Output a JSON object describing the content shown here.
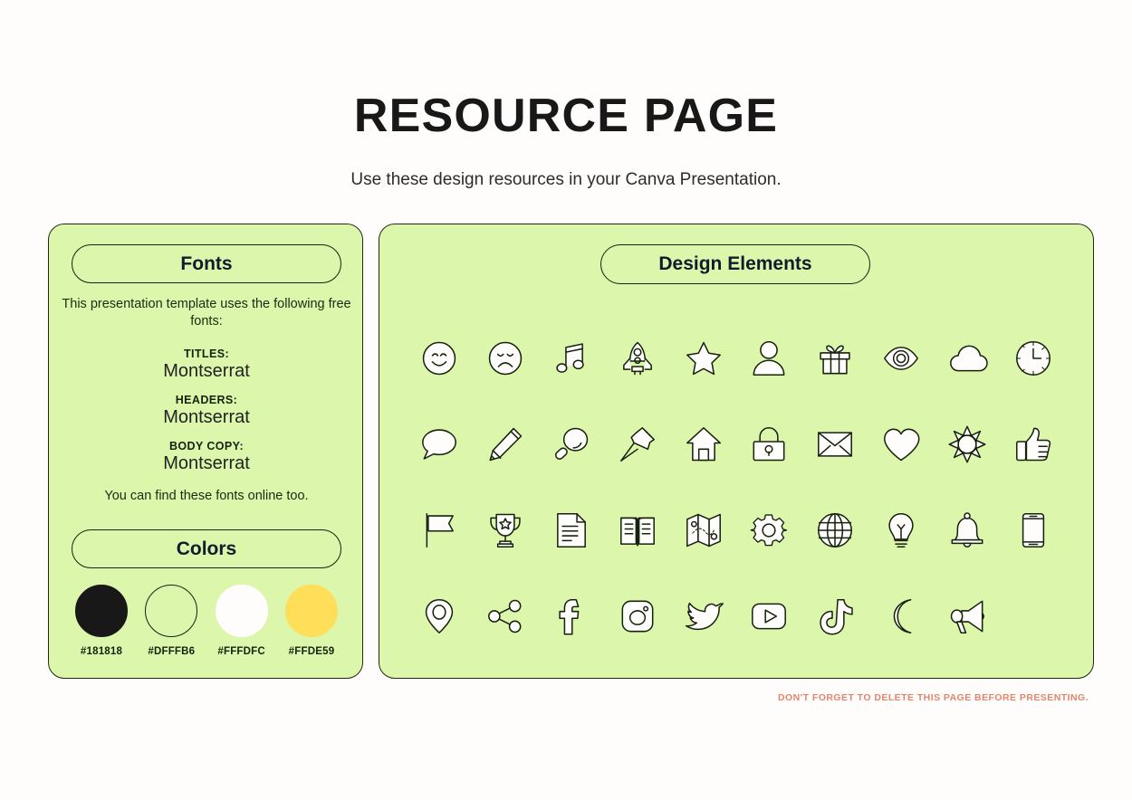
{
  "header": {
    "title": "RESOURCE PAGE",
    "subtitle": "Use these design resources in your Canva Presentation."
  },
  "fonts_panel": {
    "pill_label": "Fonts",
    "intro": "This presentation template uses the following free fonts:",
    "groups": [
      {
        "role": "TITLES:",
        "font": "Montserrat"
      },
      {
        "role": "HEADERS:",
        "font": "Montserrat"
      },
      {
        "role": "BODY COPY:",
        "font": "Montserrat"
      }
    ],
    "outro": "You can find these fonts online too."
  },
  "colors_section": {
    "pill_label": "Colors",
    "swatches": [
      {
        "hex": "#181818",
        "fill": "#181818",
        "stroke": "#181818",
        "name": "swatch-black"
      },
      {
        "hex": "#DFFFB6",
        "fill": "#dcf7ac",
        "stroke": "#16210e",
        "name": "swatch-green"
      },
      {
        "hex": "#FFFDFC",
        "fill": "#FFFDFC",
        "stroke": "#FFFDFC",
        "name": "swatch-offwhite"
      },
      {
        "hex": "#FFDE59",
        "fill": "#FFDE59",
        "stroke": "#FFDE59",
        "name": "swatch-yellow"
      }
    ]
  },
  "elements_panel": {
    "pill_label": "Design Elements",
    "icons": [
      "smiley-face-icon",
      "sad-face-icon",
      "music-note-icon",
      "rocket-icon",
      "star-icon",
      "person-icon",
      "gift-icon",
      "eye-icon",
      "cloud-icon",
      "clock-icon",
      "speech-bubble-icon",
      "pencil-icon",
      "magnifying-glass-icon",
      "pushpin-icon",
      "house-icon",
      "lock-icon",
      "envelope-icon",
      "heart-icon",
      "sun-icon",
      "thumbs-up-icon",
      "flag-icon",
      "trophy-icon",
      "document-icon",
      "book-icon",
      "map-icon",
      "gear-icon",
      "globe-icon",
      "lightbulb-icon",
      "bell-icon",
      "phone-icon",
      "location-pin-icon",
      "share-icon",
      "facebook-icon",
      "instagram-icon",
      "twitter-icon",
      "youtube-icon",
      "tiktok-icon",
      "moon-icon",
      "megaphone-icon"
    ]
  },
  "footer": {
    "note": "DON'T FORGET TO DELETE THIS PAGE BEFORE PRESENTING.",
    "note_color": "#e1866b"
  },
  "theme": {
    "background": "#FFFDFC",
    "panel_background": "#DFFFB6",
    "ink": "#181818"
  }
}
